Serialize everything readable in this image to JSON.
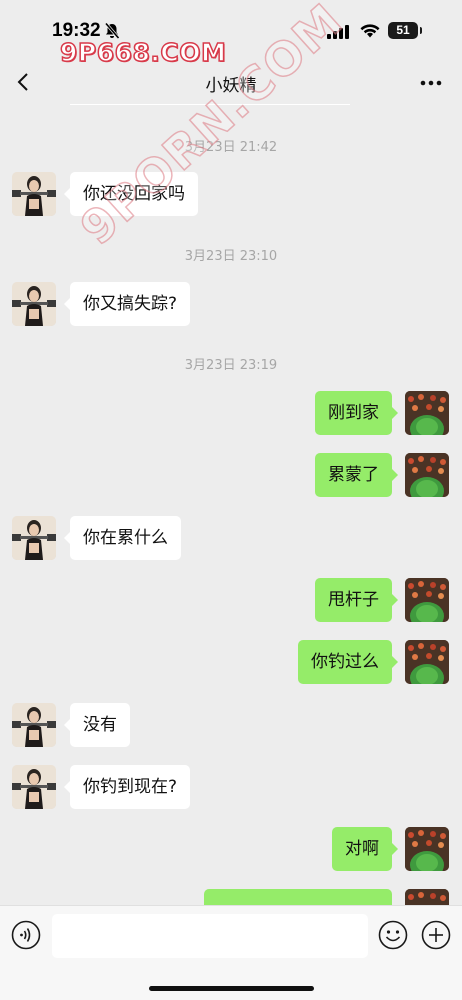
{
  "status_bar": {
    "time": "19:32",
    "battery": "51"
  },
  "watermark": {
    "top": "9P668.COM",
    "diagonal": "9PORN.COM"
  },
  "nav": {
    "title": "小妖精"
  },
  "timestamps": [
    "3月23日 21:42",
    "3月23日 23:10",
    "3月23日 23:19"
  ],
  "messages": [
    {
      "from": "her",
      "text": "你还没回家吗"
    },
    {
      "from": "her",
      "text": "你又搞失踪?"
    },
    {
      "from": "me",
      "text": "刚到家"
    },
    {
      "from": "me",
      "text": "累蒙了"
    },
    {
      "from": "her",
      "text": "你在累什么"
    },
    {
      "from": "me",
      "text": "甩杆子"
    },
    {
      "from": "me",
      "text": "你钓过么"
    },
    {
      "from": "her",
      "text": "没有"
    },
    {
      "from": "her",
      "text": "你钓到现在?"
    },
    {
      "from": "me",
      "text": "对啊"
    }
  ],
  "input": {
    "placeholder": ""
  },
  "colors": {
    "my_bubble": "#95ec69",
    "her_bubble": "#ffffff",
    "background": "#ededed"
  },
  "icons": [
    "bell-slash-icon",
    "signal-icon",
    "wifi-icon",
    "battery-icon",
    "back-icon",
    "more-icon",
    "voice-icon",
    "emoji-icon",
    "plus-icon"
  ]
}
